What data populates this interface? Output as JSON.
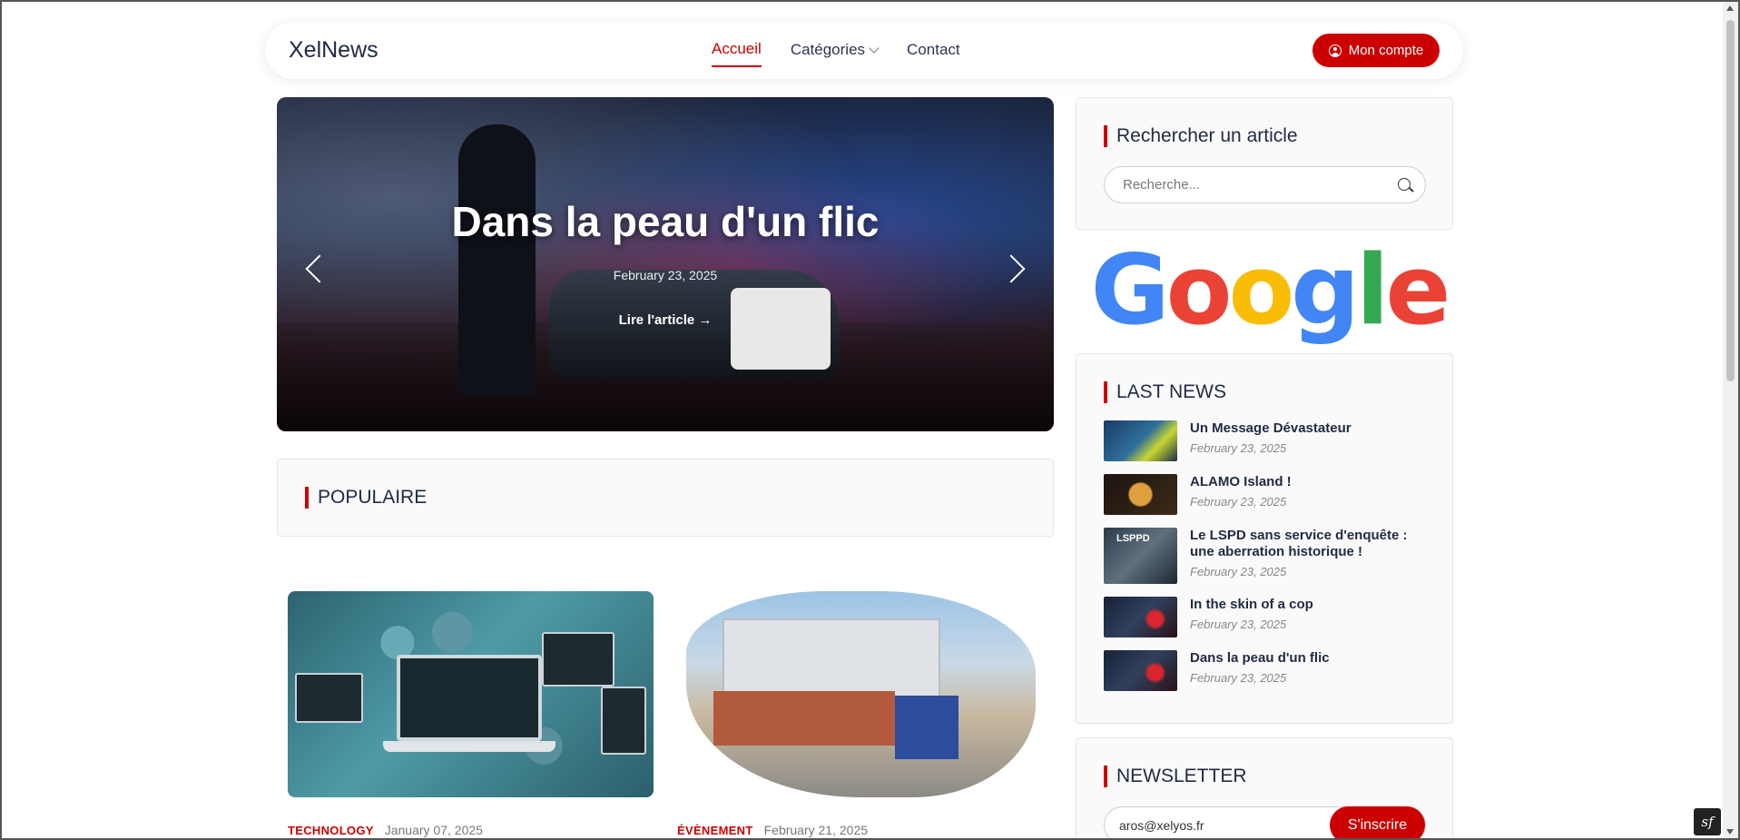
{
  "header": {
    "logo": "XelNews",
    "nav": {
      "home": "Accueil",
      "categories": "Catégories",
      "contact": "Contact"
    },
    "account_label": "Mon compte"
  },
  "hero": {
    "title": "Dans la peau d'un flic",
    "date": "February 23, 2025",
    "link_label": "Lire l'article →"
  },
  "popular": {
    "title": "POPULAIRE"
  },
  "cards": [
    {
      "category": "TECHNOLOGY",
      "date": "January 07, 2025"
    },
    {
      "category": "ÉVÈNEMENT",
      "date": "February 21, 2025"
    }
  ],
  "sidebar": {
    "search": {
      "title": "Rechercher un article",
      "placeholder": "Recherche..."
    },
    "last_news": {
      "title": "LAST NEWS",
      "items": [
        {
          "title": "Un Message Dévastateur",
          "date": "February 23, 2025"
        },
        {
          "title": "ALAMO Island !",
          "date": "February 23, 2025"
        },
        {
          "title": "Le LSPD sans service d'enquête : une aberration historique !",
          "date": "February 23, 2025"
        },
        {
          "title": "In the skin of a cop",
          "date": "February 23, 2025"
        },
        {
          "title": "Dans la peau d'un flic",
          "date": "February 23, 2025"
        }
      ]
    },
    "newsletter": {
      "title": "NEWSLETTER",
      "email_value": "aros@xelyos.fr",
      "button_label": "S'inscrire"
    }
  },
  "colors": {
    "accent": "#cc0000",
    "text": "#1f2a44"
  }
}
